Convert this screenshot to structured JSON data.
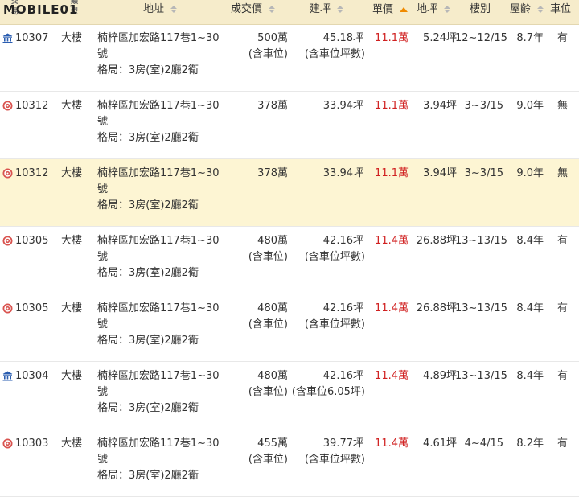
{
  "header": {
    "logo_text": "MOBILE01",
    "logo_sub1": "交易",
    "logo_sub2": "類型",
    "col_address": "地址",
    "col_price": "成交價",
    "col_building_area": "建坪",
    "col_unit_price": "單價",
    "col_land_area": "地坪",
    "col_floor": "樓別",
    "col_age": "屋齡",
    "col_parking": "車位"
  },
  "colors": {
    "header_bg": "#f6eccb",
    "highlight_bg": "#fdf5d3",
    "unit_price": "#d02020",
    "sort_active": "#f08a00"
  },
  "rows": [
    {
      "icon": "bank-icon",
      "date": "10307",
      "type": "大樓",
      "addr1": "楠梓區加宏路117巷1~30",
      "addr2": "號",
      "layout": "格局：3房(室)2廳2衛",
      "price": "500萬",
      "price_note": "(含車位)",
      "area": "45.18坪",
      "area_note": "(含車位坪數)",
      "unit": "11.1萬",
      "land": "5.24坪",
      "floor": "12~12/15",
      "age": "8.7年",
      "parking": "有",
      "highlight": false
    },
    {
      "icon": "target-icon",
      "date": "10312",
      "type": "大樓",
      "addr1": "楠梓區加宏路117巷1~30",
      "addr2": "號",
      "layout": "格局：3房(室)2廳2衛",
      "price": "378萬",
      "price_note": "",
      "area": "33.94坪",
      "area_note": "",
      "unit": "11.1萬",
      "land": "3.94坪",
      "floor": "3~3/15",
      "age": "9.0年",
      "parking": "無",
      "highlight": false
    },
    {
      "icon": "target-icon",
      "date": "10312",
      "type": "大樓",
      "addr1": "楠梓區加宏路117巷1~30",
      "addr2": "號",
      "layout": "格局：3房(室)2廳2衛",
      "price": "378萬",
      "price_note": "",
      "area": "33.94坪",
      "area_note": "",
      "unit": "11.1萬",
      "land": "3.94坪",
      "floor": "3~3/15",
      "age": "9.0年",
      "parking": "無",
      "highlight": true
    },
    {
      "icon": "target-icon",
      "date": "10305",
      "type": "大樓",
      "addr1": "楠梓區加宏路117巷1~30",
      "addr2": "號",
      "layout": "格局：3房(室)2廳2衛",
      "price": "480萬",
      "price_note": "(含車位)",
      "area": "42.16坪",
      "area_note": "(含車位坪數)",
      "unit": "11.4萬",
      "land": "26.88坪",
      "floor": "13~13/15",
      "age": "8.4年",
      "parking": "有",
      "highlight": false
    },
    {
      "icon": "target-icon",
      "date": "10305",
      "type": "大樓",
      "addr1": "楠梓區加宏路117巷1~30",
      "addr2": "號",
      "layout": "格局：3房(室)2廳2衛",
      "price": "480萬",
      "price_note": "(含車位)",
      "area": "42.16坪",
      "area_note": "(含車位坪數)",
      "unit": "11.4萬",
      "land": "26.88坪",
      "floor": "13~13/15",
      "age": "8.4年",
      "parking": "有",
      "highlight": false
    },
    {
      "icon": "bank-icon",
      "date": "10304",
      "type": "大樓",
      "addr1": "楠梓區加宏路117巷1~30",
      "addr2": "號",
      "layout": "格局：3房(室)2廳2衛",
      "price": "480萬",
      "price_note": "(含車位)",
      "area": "42.16坪",
      "area_note": "(含車位6.05坪)",
      "unit": "11.4萬",
      "land": "4.89坪",
      "floor": "13~13/15",
      "age": "8.4年",
      "parking": "有",
      "highlight": false
    },
    {
      "icon": "target-icon",
      "date": "10303",
      "type": "大樓",
      "addr1": "楠梓區加宏路117巷1~30",
      "addr2": "號",
      "layout": "格局：3房(室)2廳2衛",
      "price": "455萬",
      "price_note": "(含車位)",
      "area": "39.77坪",
      "area_note": "(含車位坪數)",
      "unit": "11.4萬",
      "land": "4.61坪",
      "floor": "4~4/15",
      "age": "8.2年",
      "parking": "有",
      "highlight": false
    }
  ]
}
